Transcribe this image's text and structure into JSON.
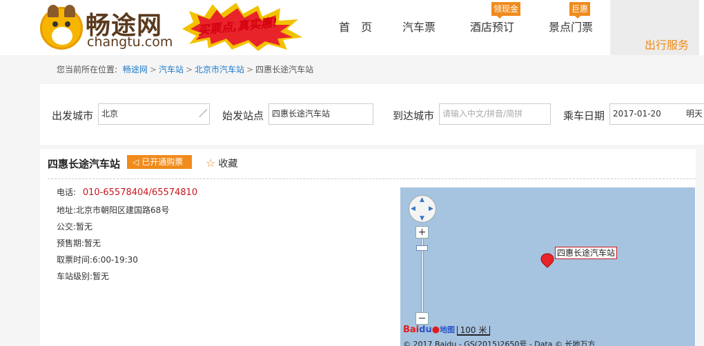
{
  "header": {
    "logo_cn": "畅途网",
    "logo_en": "changtu.com",
    "promo_text": "买票点,真实惠!",
    "nav": {
      "home": "首　页",
      "bus": "汽车票",
      "hotel": "酒店预订",
      "hotel_badge": "领现金",
      "scenic": "景点门票",
      "scenic_badge": "巨惠",
      "service": "出行服务"
    }
  },
  "breadcrumb": {
    "prefix": "您当前所在位置:",
    "items": [
      "畅途网",
      "汽车站",
      "北京市汽车站"
    ],
    "current": "四惠长途汽车站",
    "sep": ">"
  },
  "search": {
    "from_label": "出发城市",
    "from_value": "北京",
    "station_label": "始发站点",
    "station_value": "四惠长途汽车站",
    "to_label": "到达城市",
    "to_placeholder": "请输入中文/拼音/简拼",
    "date_label": "乘车日期",
    "date_value": "2017-01-20",
    "date_extra": "明天"
  },
  "station": {
    "title": "四惠长途汽车站",
    "buy_badge": "已开通购票",
    "fav": "收藏",
    "phone_label": "电话:",
    "phone_value": "010-65578404/65574810",
    "address": "地址:北京市朝阳区建国路68号",
    "bus": "公交:暂无",
    "presale": "预售期:暂无",
    "ticket_time": "取票时间:6:00-19:30",
    "level": "车站级别:暂无"
  },
  "map": {
    "marker_label": "四惠长途汽车站",
    "logo_bai": "Bai",
    "logo_du": "du",
    "logo_map": "地图",
    "scale": "100 米",
    "copyright": "© 2017 Baidu - GS(2015)2650号 - Data © 长地万方"
  },
  "colors": {
    "accent": "#f08b1c",
    "link": "#1d7ac9",
    "phone": "#c8161d",
    "map_bg": "#a6c3e0"
  }
}
